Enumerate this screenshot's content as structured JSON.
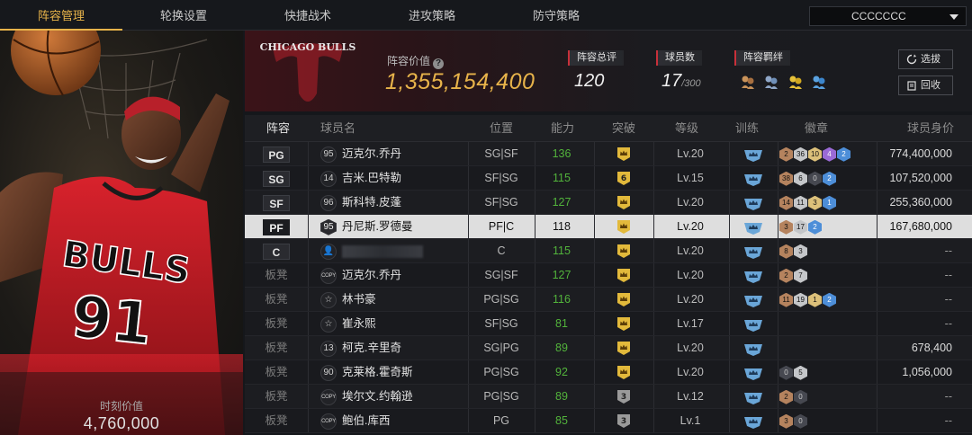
{
  "nav": {
    "tabs": [
      "阵容管理",
      "轮换设置",
      "快捷战术",
      "进攻策略",
      "防守策略"
    ],
    "active_tab": 0,
    "dropdown_value": "CCCCCCC"
  },
  "player_panel": {
    "jersey_team": "BULLS",
    "jersey_number": "91",
    "label": "时刻价值",
    "value": "4,760,000"
  },
  "header": {
    "team_logo_text": "CHICAGO BULLS",
    "lineup_value_label": "阵容价值",
    "lineup_value": "1,355,154,400",
    "overall_label": "阵容总评",
    "overall_value": "120",
    "players_label": "球员数",
    "players_value": "17",
    "players_max": "/300",
    "chemistry_label": "阵容羁绊",
    "select_button": "选拔",
    "recycle_button": "回收"
  },
  "table": {
    "headers": [
      "阵容",
      "球员名",
      "位置",
      "能力",
      "突破",
      "等级",
      "训练",
      "徽章",
      "球员身价"
    ],
    "rows": [
      {
        "slot": "PG",
        "num": "95",
        "num_type": "num",
        "name": "迈克尔.乔丹",
        "pos": "SG|SF",
        "ability": "136",
        "breakthrough": "crown",
        "level": "Lv.20",
        "badges": [
          [
            "bronze",
            "2"
          ],
          [
            "silver",
            "36"
          ],
          [
            "gold",
            "10"
          ],
          [
            "purple",
            "4"
          ],
          [
            "blue",
            "2"
          ]
        ],
        "value": "774,400,000"
      },
      {
        "slot": "SG",
        "num": "14",
        "num_type": "num",
        "name": "吉米.巴特勒",
        "pos": "SF|SG",
        "ability": "115",
        "breakthrough": "6",
        "level": "Lv.15",
        "badges": [
          [
            "bronze",
            "38"
          ],
          [
            "silver",
            "6"
          ],
          [
            "dark",
            "0"
          ],
          [
            "blue",
            "2"
          ]
        ],
        "value": "107,520,000"
      },
      {
        "slot": "SF",
        "num": "96",
        "num_type": "num",
        "name": "斯科特.皮蓬",
        "pos": "SF|SG",
        "ability": "127",
        "breakthrough": "crown",
        "level": "Lv.20",
        "badges": [
          [
            "bronze",
            "14"
          ],
          [
            "silver",
            "11"
          ],
          [
            "gold",
            "3"
          ],
          [
            "blue",
            "1"
          ]
        ],
        "value": "255,360,000"
      },
      {
        "slot": "PF",
        "num": "95",
        "num_type": "hex",
        "name": "丹尼斯.罗德曼",
        "pos": "PF|C",
        "ability": "118",
        "breakthrough": "crown",
        "level": "Lv.20",
        "badges": [
          [
            "bronze",
            "3"
          ],
          [
            "silver",
            "17"
          ],
          [
            "blue",
            "2"
          ]
        ],
        "value": "167,680,000"
      },
      {
        "slot": "C",
        "num": "",
        "num_type": "user",
        "name": "",
        "pos": "C",
        "ability": "115",
        "breakthrough": "crown",
        "level": "Lv.20",
        "badges": [
          [
            "bronze",
            "8"
          ],
          [
            "silver",
            "3"
          ]
        ],
        "value": "--"
      },
      {
        "slot": "板凳",
        "num": "COPY",
        "num_type": "copy",
        "name": "迈克尔.乔丹",
        "pos": "SG|SF",
        "ability": "127",
        "breakthrough": "crown",
        "level": "Lv.20",
        "badges": [
          [
            "bronze",
            "2"
          ],
          [
            "silver",
            "7"
          ]
        ],
        "value": "--"
      },
      {
        "slot": "板凳",
        "num": "",
        "num_type": "star",
        "name": "林书豪",
        "pos": "PG|SG",
        "ability": "116",
        "breakthrough": "crown",
        "level": "Lv.20",
        "badges": [
          [
            "bronze",
            "11"
          ],
          [
            "silver",
            "19"
          ],
          [
            "gold",
            "1"
          ],
          [
            "blue",
            "2"
          ]
        ],
        "value": "--"
      },
      {
        "slot": "板凳",
        "num": "",
        "num_type": "star",
        "name": "崔永熙",
        "pos": "SF|SG",
        "ability": "81",
        "breakthrough": "crown",
        "level": "Lv.17",
        "badges": [],
        "value": "--"
      },
      {
        "slot": "板凳",
        "num": "13",
        "num_type": "num",
        "name": "柯克.辛里奇",
        "pos": "SG|PG",
        "ability": "89",
        "breakthrough": "crown",
        "level": "Lv.20",
        "badges": [],
        "value": "678,400"
      },
      {
        "slot": "板凳",
        "num": "90",
        "num_type": "num",
        "name": "克莱格.霍奇斯",
        "pos": "PG|SG",
        "ability": "92",
        "breakthrough": "crown",
        "level": "Lv.20",
        "badges": [
          [
            "dark",
            "0"
          ],
          [
            "silver",
            "5"
          ]
        ],
        "value": "1,056,000"
      },
      {
        "slot": "板凳",
        "num": "COPY",
        "num_type": "copy",
        "name": "埃尔文.约翰逊",
        "pos": "PG|SG",
        "ability": "89",
        "breakthrough": "3",
        "level": "Lv.12",
        "badges": [
          [
            "bronze",
            "2"
          ],
          [
            "dark",
            "0"
          ]
        ],
        "value": "--"
      },
      {
        "slot": "板凳",
        "num": "COPY",
        "num_type": "copy",
        "name": "鲍伯.库西",
        "pos": "PG",
        "ability": "85",
        "breakthrough": "3",
        "level": "Lv.1",
        "badges": [
          [
            "bronze",
            "3"
          ],
          [
            "dark",
            "0"
          ]
        ],
        "value": "--"
      }
    ]
  },
  "colors": {
    "accent": "#e7b34a",
    "ability_green": "#52b33b",
    "tag_red": "#c8303a"
  }
}
